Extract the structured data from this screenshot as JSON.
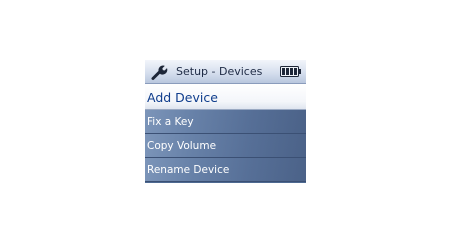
{
  "header": {
    "title": "Setup - Devices",
    "icon": "wrench-icon",
    "battery": "battery-icon"
  },
  "menu": {
    "items": [
      {
        "label": "Add Device",
        "selected": true
      },
      {
        "label": "Fix a Key",
        "selected": false
      },
      {
        "label": "Copy Volume",
        "selected": false
      },
      {
        "label": "Rename Device",
        "selected": false
      }
    ]
  },
  "colors": {
    "screen_background": "#4e6a92",
    "selected_text": "#0f3d8c",
    "item_text": "#ffffff"
  }
}
